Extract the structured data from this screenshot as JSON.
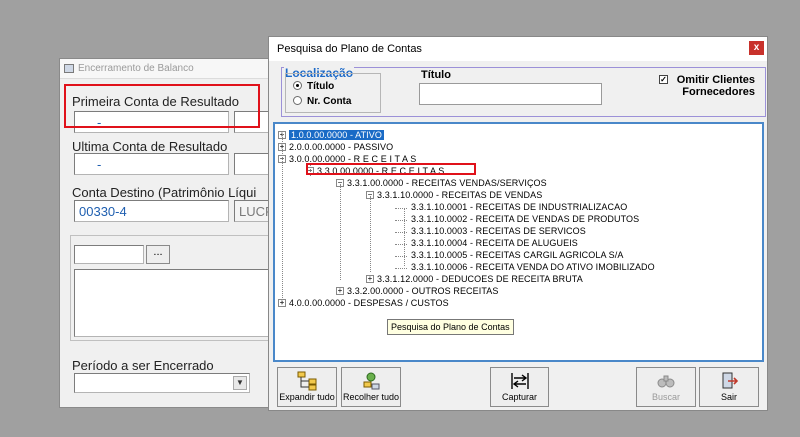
{
  "bg_window": {
    "title": "Encerramento de Balanco",
    "group1": "Primeira Conta de Resultado",
    "group1_value": "-",
    "group2": "Ultima Conta de Resultado",
    "group2_value": "-",
    "group3": "Conta Destino (Patrimônio Líqui",
    "group3_value": "00330-4",
    "group3_value2": "LUCR",
    "browse_label": "...",
    "period_label": "Período a ser Encerrado"
  },
  "dialog": {
    "title": "Pesquisa do Plano de Contas",
    "close": "x",
    "localizacao": "Localização",
    "radio_titulo": "Título",
    "radio_nr": "Nr. Conta",
    "titulo_label": "Título",
    "omit_line1": "Omitir Clientes",
    "omit_line2": "Fornecedores",
    "tooltip": "Pesquisa do Plano de Contas",
    "buttons": {
      "expand": "Expandir tudo",
      "collapse": "Recolher tudo",
      "capture": "Capturar",
      "search": "Buscar",
      "exit": "Sair"
    },
    "tree": [
      {
        "code": "1.0.0.00.0000",
        "name": "ATIVO"
      },
      {
        "code": "2.0.0.00.0000",
        "name": "PASSIVO"
      },
      {
        "code": "3.0.0.00.0000",
        "name": "R E C E I T A S"
      },
      {
        "code": "3.3.0.00.0000",
        "name": "R E C E I T A S"
      },
      {
        "code": "3.3.1.00.0000",
        "name": "RECEITAS VENDAS/SERVIÇOS"
      },
      {
        "code": "3.3.1.10.0000",
        "name": "RECEITAS DE VENDAS"
      },
      {
        "code": "3.3.1.10.0001",
        "name": "RECEITAS DE INDUSTRIALIZACAO"
      },
      {
        "code": "3.3.1.10.0002",
        "name": "RECEITA DE VENDAS DE PRODUTOS"
      },
      {
        "code": "3.3.1.10.0003",
        "name": "RECEITAS DE SERVICOS"
      },
      {
        "code": "3.3.1.10.0004",
        "name": "RECEITA DE ALUGUEIS"
      },
      {
        "code": "3.3.1.10.0005",
        "name": "RECEITAS  CARGIL AGRICOLA S/A"
      },
      {
        "code": "3.3.1.10.0006",
        "name": "RECEITA VENDA DO ATIVO IMOBILIZADO"
      },
      {
        "code": "3.3.1.12.0000",
        "name": "DEDUCOES DE RECEITA BRUTA"
      },
      {
        "code": "3.3.2.00.0000",
        "name": "OUTROS RECEITAS"
      },
      {
        "code": "4.0.0.00.0000",
        "name": "DESPESAS / CUSTOS"
      }
    ]
  }
}
